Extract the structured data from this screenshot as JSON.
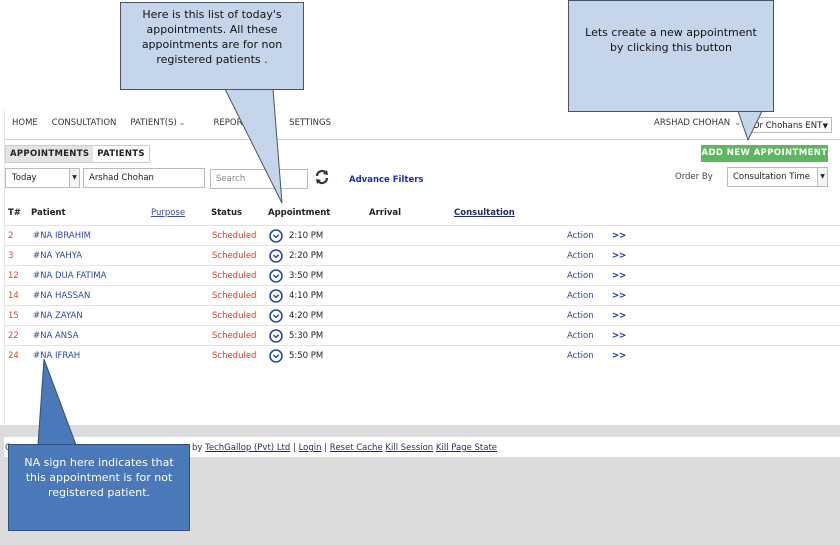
{
  "nav": {
    "items": [
      "HOME",
      "CONSULTATION",
      "PATIENT(S)",
      "REPORTS",
      "SETTINGS"
    ],
    "user": "ARSHAD CHOHAN",
    "clinic": "Dr Chohans ENT"
  },
  "tabs": [
    "APPOINTMENTS",
    "PATIENTS"
  ],
  "add_button": "ADD NEW APPOINTMENT",
  "filters": {
    "date": "Today",
    "doctor": "Arshad Chohan",
    "search_placeholder": "Search",
    "advance": "Advance Filters",
    "order_label": "Order By",
    "order_value": "Consultation Time"
  },
  "table": {
    "headers": {
      "tno": "T#",
      "patient": "Patient",
      "purpose": "Purpose",
      "status": "Status",
      "appointment": "Appointment",
      "arrival": "Arrival",
      "consultation": "Consultation"
    },
    "rows": [
      {
        "t": "2",
        "patient": "#NA IBRAHIM",
        "status": "Scheduled",
        "time": "2:10 PM",
        "action": "Action",
        "more": ">>"
      },
      {
        "t": "3",
        "patient": "#NA YAHYA",
        "status": "Scheduled",
        "time": "2:20 PM",
        "action": "Action",
        "more": ">>"
      },
      {
        "t": "12",
        "patient": "#NA DUA FATIMA",
        "status": "Scheduled",
        "time": "3:50 PM",
        "action": "Action",
        "more": ">>"
      },
      {
        "t": "14",
        "patient": "#NA HASSAN",
        "status": "Scheduled",
        "time": "4:10 PM",
        "action": "Action",
        "more": ">>"
      },
      {
        "t": "15",
        "patient": "#NA ZAYAN",
        "status": "Scheduled",
        "time": "4:20 PM",
        "action": "Action",
        "more": ">>"
      },
      {
        "t": "22",
        "patient": "#NA ANSA",
        "status": "Scheduled",
        "time": "5:30 PM",
        "action": "Action",
        "more": ">>"
      },
      {
        "t": "24",
        "patient": "#NA IFRAH",
        "status": "Scheduled",
        "time": "5:50 PM",
        "action": "Action",
        "more": ">>"
      }
    ]
  },
  "footer": {
    "c": "C",
    "by": "by",
    "company": "TechGallop (Pvt) Ltd",
    "login": "Login",
    "reset": "Reset Cache",
    "kill_session": "Kill Session",
    "kill_page": "Kill Page State"
  },
  "callouts": {
    "list": "Here is this list of today's appointments. All these appointments are for non registered patients .",
    "create": "Lets create a new appointment by clicking this button",
    "na": "NA sign here indicates that this appointment is for not registered patient."
  },
  "colors": {
    "accent_green": "#5cb85c",
    "status_red": "#e03a2a",
    "link_blue": "#1a2fb8",
    "callout_light": "#c6d6ea",
    "callout_dark": "#4a78b8"
  }
}
